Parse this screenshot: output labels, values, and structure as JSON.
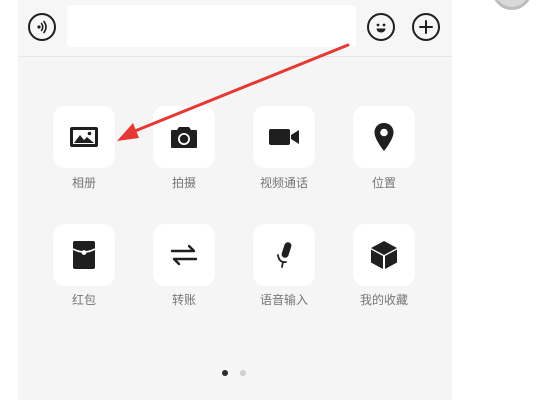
{
  "input_bar": {
    "voice_icon": "voice-icon",
    "emoji_icon": "emoji-icon",
    "plus_icon": "plus-icon",
    "message_value": "",
    "message_placeholder": ""
  },
  "panel": {
    "items": [
      {
        "label": "相册",
        "icon": "album-icon"
      },
      {
        "label": "拍摄",
        "icon": "camera-icon"
      },
      {
        "label": "视频通话",
        "icon": "video-call-icon"
      },
      {
        "label": "位置",
        "icon": "location-icon"
      },
      {
        "label": "红包",
        "icon": "red-packet-icon"
      },
      {
        "label": "转账",
        "icon": "transfer-icon"
      },
      {
        "label": "语音输入",
        "icon": "voice-input-icon"
      },
      {
        "label": "我的收藏",
        "icon": "favorites-icon"
      }
    ],
    "page_indicator": {
      "current": 1,
      "total": 2
    }
  },
  "annotation": {
    "arrow_color": "#e53935",
    "arrow_icon": "red-arrow-icon"
  },
  "colors": {
    "panel_bg": "#f5f5f5",
    "tile_bg": "#ffffff",
    "icon": "#1f1f1f",
    "label": "#767676",
    "dot_active": "#2b2b2b",
    "dot_inactive": "#cfcfcf"
  }
}
